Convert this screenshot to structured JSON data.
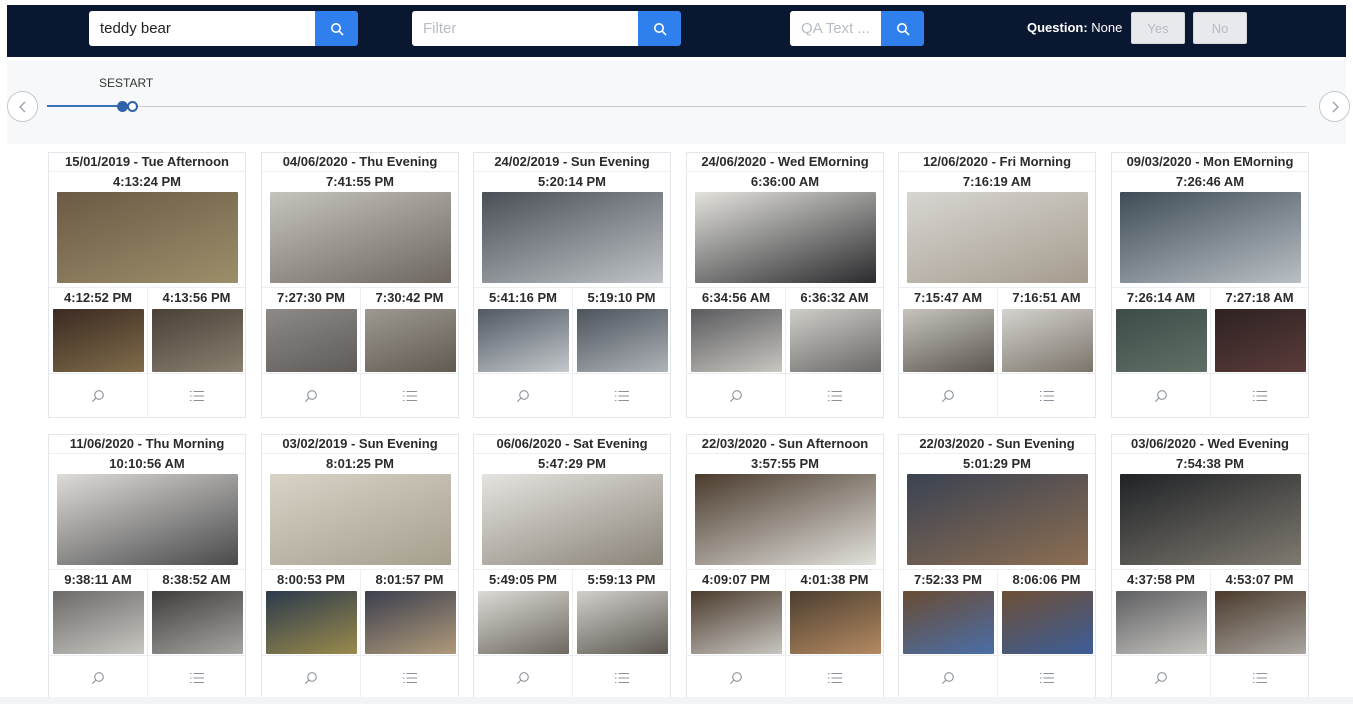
{
  "toolbar": {
    "search_value": "teddy bear",
    "filter_placeholder": "Filter",
    "qa_placeholder": "QA Text ...",
    "question_label": "Question:",
    "question_value": "None",
    "yes_label": "Yes",
    "no_label": "No"
  },
  "timeline": {
    "label_overlap": "SESTART"
  },
  "icons": {
    "search": "search-icon",
    "zoom": "magnifier-icon",
    "list": "list-icon",
    "prev": "chevron-left-icon",
    "next": "chevron-right-icon"
  },
  "colors": {
    "topbar": "#0a1730",
    "accent": "#2f80ed",
    "timeline": "#3a72b8"
  },
  "cards": [
    {
      "date": "15/01/2019 - Tue Afternoon",
      "time": "4:13:24 PM",
      "left_time": "4:12:52 PM",
      "right_time": "4:13:56 PM",
      "main_color": [
        "#6b5a45",
        "#9b8f6a"
      ],
      "left_color": [
        "#3a2a22",
        "#806c4a"
      ],
      "right_color": [
        "#494038",
        "#8a8070"
      ]
    },
    {
      "date": "04/06/2020 - Thu Evening",
      "time": "7:41:55 PM",
      "left_time": "7:27:30 PM",
      "right_time": "7:30:42 PM",
      "main_color": [
        "#c6c3bd",
        "#6d6760"
      ],
      "left_color": [
        "#8d8a88",
        "#5e5b59"
      ],
      "right_color": [
        "#9d9890",
        "#605a52"
      ]
    },
    {
      "date": "24/02/2019 - Sun Evening",
      "time": "5:20:14 PM",
      "left_time": "5:41:16 PM",
      "right_time": "5:19:10 PM",
      "main_color": [
        "#4a4f57",
        "#bfc3c7"
      ],
      "left_color": [
        "#505862",
        "#c4c8cc"
      ],
      "right_color": [
        "#4d535c",
        "#aeb3b8"
      ]
    },
    {
      "date": "24/06/2020 - Wed EMorning",
      "time": "6:36:00 AM",
      "left_time": "6:34:56 AM",
      "right_time": "6:36:32 AM",
      "main_color": [
        "#e3e2dd",
        "#2b2b2e"
      ],
      "left_color": [
        "#5a5a5e",
        "#c8c6c0"
      ],
      "right_color": [
        "#cfcdc8",
        "#6a6968"
      ]
    },
    {
      "date": "12/06/2020 - Fri Morning",
      "time": "7:16:19 AM",
      "left_time": "7:15:47 AM",
      "right_time": "7:16:51 AM",
      "main_color": [
        "#d8d6d2",
        "#a59c8e"
      ],
      "left_color": [
        "#c7c4be",
        "#5b5650"
      ],
      "right_color": [
        "#d5d3cf",
        "#7b746a"
      ]
    },
    {
      "date": "09/03/2020 - Mon EMorning",
      "time": "7:26:46 AM",
      "left_time": "7:26:14 AM",
      "right_time": "7:27:18 AM",
      "main_color": [
        "#3f4c57",
        "#b9c0c4"
      ],
      "left_color": [
        "#3e4b48",
        "#607066"
      ],
      "right_color": [
        "#2e2222",
        "#5a3b3a"
      ]
    },
    {
      "date": "11/06/2020 - Thu Morning",
      "time": "10:10:56 AM",
      "left_time": "9:38:11 AM",
      "right_time": "8:38:52 AM",
      "main_color": [
        "#dedcd8",
        "#4a4a4c"
      ],
      "left_color": [
        "#6b6a68",
        "#c9c7c2"
      ],
      "right_color": [
        "#3e3d3c",
        "#a8a6a2"
      ]
    },
    {
      "date": "03/02/2019 - Sun Evening",
      "time": "8:01:25 PM",
      "left_time": "8:00:53 PM",
      "right_time": "8:01:57 PM",
      "main_color": [
        "#d8d3c7",
        "#a69f8f"
      ],
      "left_color": [
        "#2b3a4c",
        "#9a8a4c"
      ],
      "right_color": [
        "#3b3f4e",
        "#b09a7a"
      ]
    },
    {
      "date": "06/06/2020 - Sat Evening",
      "time": "5:47:29 PM",
      "left_time": "5:49:05 PM",
      "right_time": "5:59:13 PM",
      "main_color": [
        "#e5e4e0",
        "#8a8378"
      ],
      "left_color": [
        "#dcdad5",
        "#6c6860"
      ],
      "right_color": [
        "#d2d0cc",
        "#5b5750"
      ]
    },
    {
      "date": "22/03/2020 - Sun Afternoon",
      "time": "3:57:55 PM",
      "left_time": "4:09:07 PM",
      "right_time": "4:01:38 PM",
      "main_color": [
        "#4a3a2c",
        "#e2e1dc"
      ],
      "left_color": [
        "#4b3b2d",
        "#c8c6c1"
      ],
      "right_color": [
        "#4c3e30",
        "#b48a62"
      ]
    },
    {
      "date": "22/03/2020 - Sun Evening",
      "time": "5:01:29 PM",
      "left_time": "7:52:33 PM",
      "right_time": "8:06:06 PM",
      "main_color": [
        "#3a4252",
        "#8c6e52"
      ],
      "left_color": [
        "#6a4c34",
        "#4a6ea8"
      ],
      "right_color": [
        "#6e4f36",
        "#3b5d98"
      ]
    },
    {
      "date": "03/06/2020 - Wed Evening",
      "time": "7:54:38 PM",
      "left_time": "4:37:58 PM",
      "right_time": "4:53:07 PM",
      "main_color": [
        "#1f2226",
        "#7f7a70"
      ],
      "left_color": [
        "#5e5f62",
        "#c5c3bf"
      ],
      "right_color": [
        "#4b3a2c",
        "#a9a6a0"
      ]
    }
  ]
}
